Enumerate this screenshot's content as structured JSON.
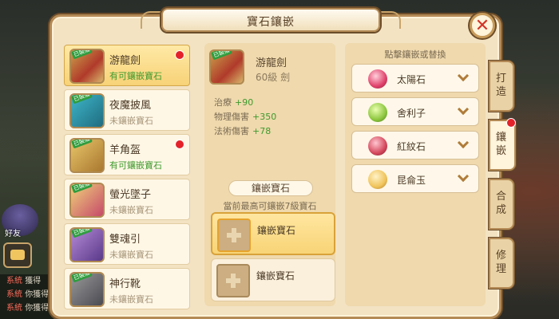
{
  "window": {
    "title": "寶石鑲嵌",
    "close_icon": "close-icon"
  },
  "items": [
    {
      "name": "游龍劍",
      "status": "有可鑲嵌寶石",
      "tag": "已裝備",
      "has_gem": true,
      "alert": true,
      "selected": true,
      "icon": "sword-icon"
    },
    {
      "name": "夜魔披風",
      "status": "未鑲嵌寶石",
      "tag": "已裝備",
      "has_gem": false,
      "alert": false,
      "selected": false,
      "icon": "cloak-icon"
    },
    {
      "name": "羊角盔",
      "status": "有可鑲嵌寶石",
      "tag": "已裝備",
      "has_gem": true,
      "alert": true,
      "selected": false,
      "icon": "helmet-icon"
    },
    {
      "name": "螢光墜子",
      "status": "未鑲嵌寶石",
      "tag": "已裝備",
      "has_gem": false,
      "alert": false,
      "selected": false,
      "icon": "pendant-icon"
    },
    {
      "name": "雙魂引",
      "status": "未鑲嵌寶石",
      "tag": "已裝備",
      "has_gem": false,
      "alert": false,
      "selected": false,
      "icon": "bracer-icon"
    },
    {
      "name": "神行靴",
      "status": "未鑲嵌寶石",
      "tag": "已裝備",
      "has_gem": false,
      "alert": false,
      "selected": false,
      "icon": "boots-icon"
    }
  ],
  "detail": {
    "name": "游龍劍",
    "level": "60級 劍",
    "tag": "已裝備",
    "stats": [
      {
        "label": "治療",
        "value": "+90"
      },
      {
        "label": "物理傷害",
        "value": "+350"
      },
      {
        "label": "法術傷害",
        "value": "+78"
      }
    ],
    "gem_header": "鑲嵌寶石",
    "gem_note": "當前最高可鑲嵌7級寶石",
    "slots": [
      {
        "label": "鑲嵌寶石",
        "active": true
      },
      {
        "label": "鑲嵌寶石",
        "active": false
      }
    ]
  },
  "gems": {
    "header": "點擊鑲嵌或替換",
    "list": [
      {
        "name": "太陽石",
        "color": "#e0416b",
        "icon": "sun-stone-icon"
      },
      {
        "name": "舍利子",
        "color": "#8cc63e",
        "icon": "relic-icon"
      },
      {
        "name": "紅紋石",
        "color": "#d4475c",
        "icon": "red-stone-icon"
      },
      {
        "name": "昆侖玉",
        "color": "#f0c35a",
        "icon": "jade-icon"
      }
    ]
  },
  "tabs": [
    {
      "label": "打造",
      "active": false,
      "alert": false
    },
    {
      "label": "鑲嵌",
      "active": true,
      "alert": true
    },
    {
      "label": "合成",
      "active": false,
      "alert": false
    },
    {
      "label": "修理",
      "active": false,
      "alert": false
    }
  ],
  "background": {
    "friend_label": "好友",
    "chat_lines": [
      {
        "tag": "系統",
        "text": "獲得"
      },
      {
        "tag": "系統",
        "text": "你獲得"
      },
      {
        "tag": "系統",
        "text": "你獲得"
      }
    ]
  },
  "colors": {
    "alert_red": "#e4222a",
    "stat_green": "#3e9a2d",
    "panel_bg": "#f3e3c3",
    "selected_gold": "#f7d277"
  }
}
